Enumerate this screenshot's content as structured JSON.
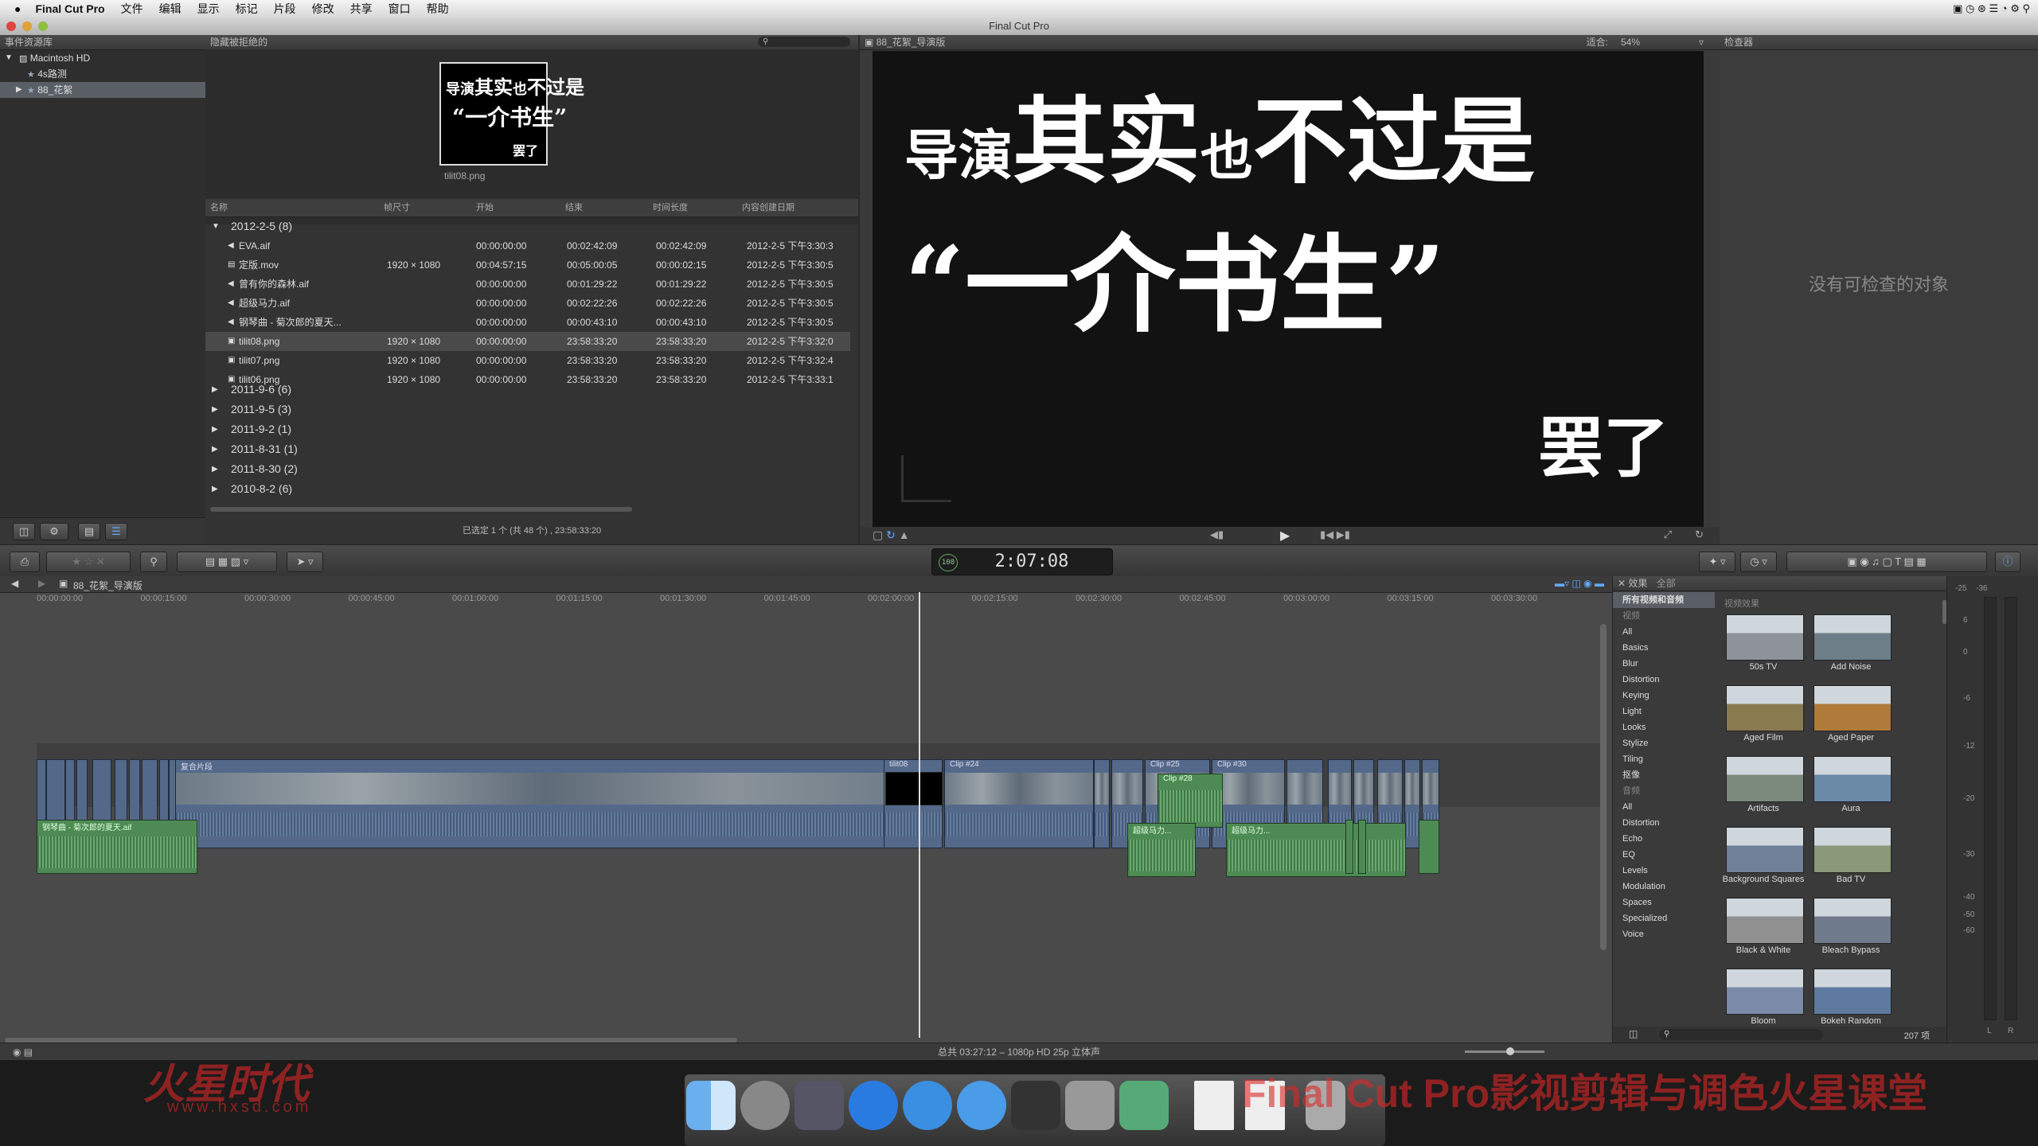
{
  "menubar": {
    "app": "Final Cut Pro",
    "items": [
      "文件",
      "编辑",
      "显示",
      "标记",
      "片段",
      "修改",
      "共享",
      "窗口",
      "帮助"
    ]
  },
  "window_title": "Final Cut Pro",
  "library": {
    "header": "事件资源库",
    "items": [
      {
        "label": "Macintosh HD"
      },
      {
        "label": "4s路测"
      },
      {
        "label": "88_花絮"
      }
    ]
  },
  "browser": {
    "header": "隐藏被拒绝的",
    "thumb_caption": "tilit08.png",
    "columns": [
      "名称",
      "帧尺寸",
      "开始",
      "结束",
      "时间长度",
      "内容创建日期"
    ],
    "group_open": "2012-2-5  (8)",
    "rows": [
      {
        "name": "EVA.aif",
        "size": "",
        "start": "00:00:00:00",
        "end": "00:02:42:09",
        "dur": "00:02:42:09",
        "date": "2012-2-5 下午3:30:3"
      },
      {
        "name": "定版.mov",
        "size": "1920 × 1080",
        "start": "00:04:57:15",
        "end": "00:05:00:05",
        "dur": "00:00:02:15",
        "date": "2012-2-5 下午3:30:5"
      },
      {
        "name": "曾有你的森林.aif",
        "size": "",
        "start": "00:00:00:00",
        "end": "00:01:29:22",
        "dur": "00:01:29:22",
        "date": "2012-2-5 下午3:30:5"
      },
      {
        "name": "超级马力.aif",
        "size": "",
        "start": "00:00:00:00",
        "end": "00:02:22:26",
        "dur": "00:02:22:26",
        "date": "2012-2-5 下午3:30:5"
      },
      {
        "name": "钢琴曲 - 菊次郎的夏天...",
        "size": "",
        "start": "00:00:00:00",
        "end": "00:00:43:10",
        "dur": "00:00:43:10",
        "date": "2012-2-5 下午3:30:5"
      },
      {
        "name": "tilit08.png",
        "size": "1920 × 1080",
        "start": "00:00:00:00",
        "end": "23:58:33:20",
        "dur": "23:58:33:20",
        "date": "2012-2-5 下午3:32:0"
      },
      {
        "name": "tilit07.png",
        "size": "1920 × 1080",
        "start": "00:00:00:00",
        "end": "23:58:33:20",
        "dur": "23:58:33:20",
        "date": "2012-2-5 下午3:32:4"
      },
      {
        "name": "tilit06.png",
        "size": "1920 × 1080",
        "start": "00:00:00:00",
        "end": "23:58:33:20",
        "dur": "23:58:33:20",
        "date": "2012-2-5 下午3:33:1"
      }
    ],
    "groups": [
      "2011-9-6  (6)",
      "2011-9-5  (3)",
      "2011-9-2  (1)",
      "2011-8-31  (1)",
      "2011-8-30  (2)",
      "2010-8-2  (6)"
    ],
    "footer": "已选定 1 个 (共 48 个) , 23:58:33:20"
  },
  "viewer": {
    "title": "88_花絮_导演版",
    "fit_label": "适合:",
    "zoom": "54%",
    "line1a": "导演",
    "line1b": "其实",
    "line1c": "也",
    "line1d": "不过是",
    "line2": "“一介书生”",
    "line3": "罢了"
  },
  "inspector": {
    "header": "检查器",
    "empty": "没有可检查的对象"
  },
  "toolbar": {
    "timecode": "2:07:08",
    "timecode_pct": "100"
  },
  "timeline": {
    "project": "88_花絮_导演版",
    "ruler": [
      "00:00:00:00",
      "00:00:15:00",
      "00:00:30:00",
      "00:00:45:00",
      "00:01:00:00",
      "00:01:15:00",
      "00:01:30:00",
      "00:01:45:00",
      "00:02:00:00",
      "00:02:15:00",
      "00:02:30:00",
      "00:02:45:00",
      "00:03:00:00",
      "00:03:15:00",
      "00:03:30:00"
    ],
    "clip_labels": [
      "复合片段",
      "tilit08",
      "Clip #24",
      "Clip #25",
      "Clip #30",
      "钢琴曲 - 菊次郎的夏天.aif",
      "Clip #28",
      "超级马力...",
      "超级马力..."
    ]
  },
  "effects": {
    "header": "效果",
    "header_all": "全部",
    "top_cat": "所有视频和音频",
    "section_video": "视频",
    "section_audio": "音频",
    "sub_header": "视频效果",
    "video_cats": [
      "All",
      "Basics",
      "Blur",
      "Distortion",
      "Keying",
      "Light",
      "Looks",
      "Stylize",
      "Tiling",
      "抠像"
    ],
    "audio_cats": [
      "All",
      "Distortion",
      "Echo",
      "EQ",
      "Levels",
      "Modulation",
      "Spaces",
      "Specialized",
      "Voice"
    ],
    "items": [
      "50s TV",
      "Add Noise",
      "Aged Film",
      "Aged Paper",
      "Artifacts",
      "Aura",
      "Background Squares",
      "Bad TV",
      "Black & White",
      "Bleach Bypass",
      "Bloom",
      "Bokeh Random"
    ],
    "count": "207 项",
    "colors": [
      "#8d9398",
      "#6d7e88",
      "#8a7a50",
      "#b07a3a",
      "#7c8a7e",
      "#6a8aa8",
      "#6f8098",
      "#8a9a78",
      "#909090",
      "#6f7a8a",
      "#7a8aa8",
      "#5e7aa0"
    ]
  },
  "meters": {
    "labels": [
      "-25",
      "-36",
      "6",
      "0",
      "-6",
      "-12",
      "-20",
      "-30",
      "-40",
      "-50",
      "-60",
      "L",
      "R"
    ]
  },
  "status": "总共 03:27:12 – 1080p HD 25p 立体声",
  "watermark": {
    "logo": "火星时代",
    "url": "www.hxsd.com",
    "caption": "Final Cut Pro影视剪辑与调色火星课堂"
  }
}
